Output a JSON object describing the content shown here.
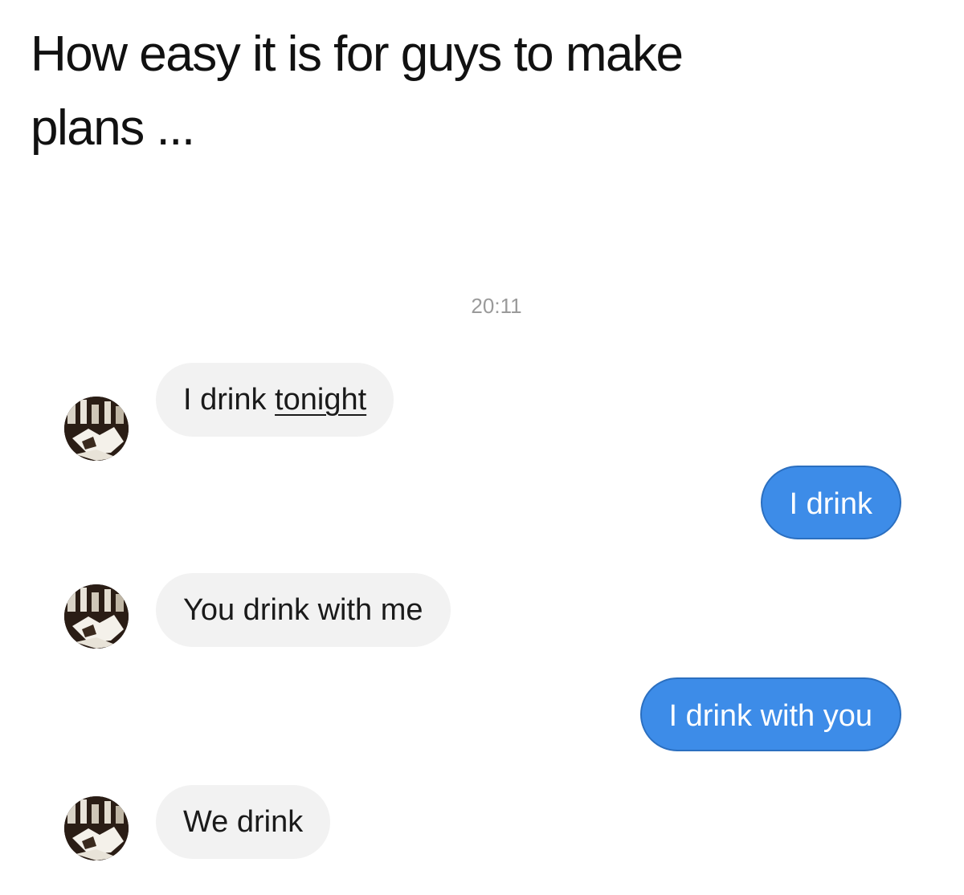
{
  "caption": {
    "line1": "How easy it is for guys to make",
    "line2": "plans ..."
  },
  "thread": {
    "timestamp": "20:11",
    "messages": [
      {
        "direction": "incoming",
        "text_before": "I drink ",
        "text_link": "tonight"
      },
      {
        "direction": "outgoing",
        "text": "I drink"
      },
      {
        "direction": "incoming",
        "text": "You drink with me"
      },
      {
        "direction": "outgoing",
        "text": "I drink with you"
      },
      {
        "direction": "incoming",
        "text": "We drink"
      }
    ]
  },
  "colors": {
    "incoming_bubble": "#f2f2f2",
    "outgoing_bubble": "#3d8ce8",
    "timestamp": "#9a9a9a"
  }
}
